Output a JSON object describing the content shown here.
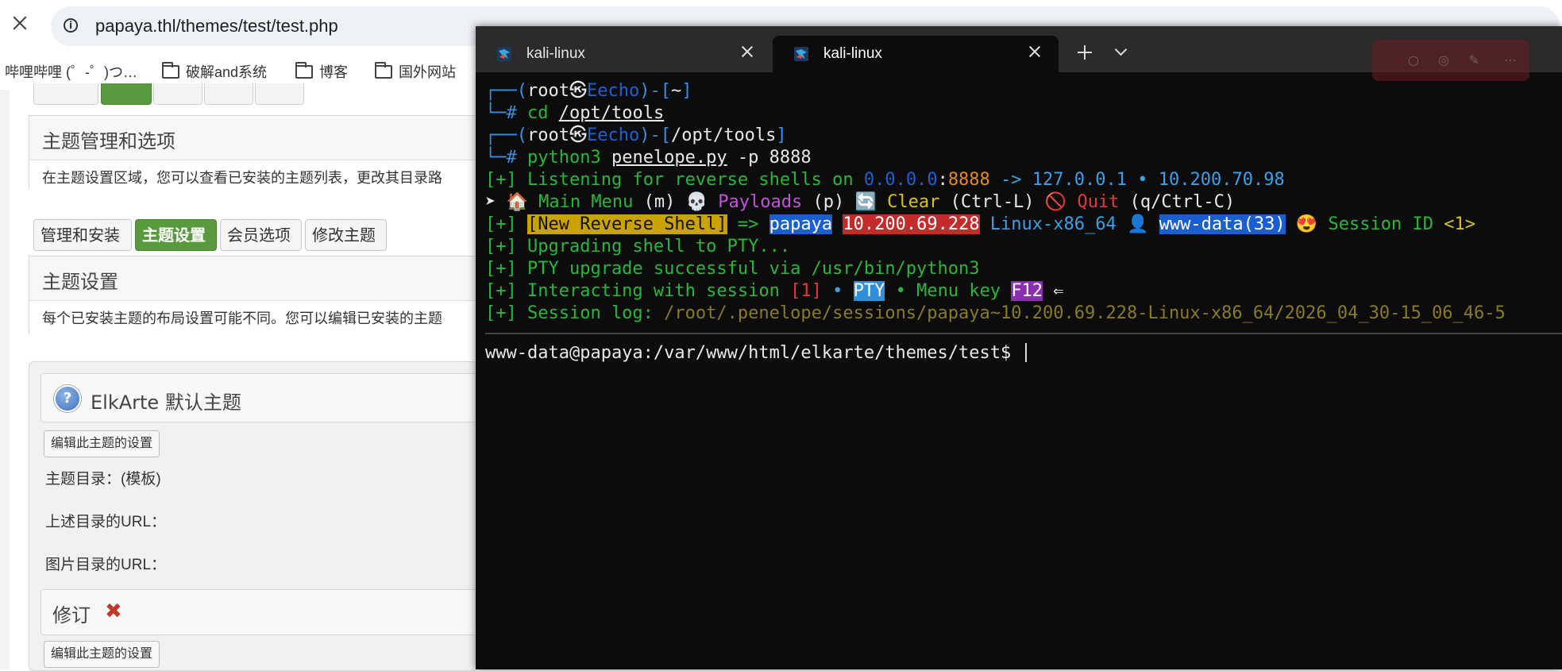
{
  "browser": {
    "url": "papaya.thl/themes/test/test.php",
    "bookmarks": [
      "哔哩哔哩 (゜-゜)つ…",
      "破解and系统",
      "博客",
      "国外网站"
    ]
  },
  "forum": {
    "section1": {
      "title": "主题管理和选项",
      "desc": "在主题设置区域，您可以查看已安装的主题列表，更改其目录路"
    },
    "tabs": [
      "管理和安装",
      "主题设置",
      "会员选项",
      "修改主题"
    ],
    "section2": {
      "title": "主题设置",
      "desc": "每个已安装主题的布局设置可能不同。您可以编辑已安装的主题"
    },
    "theme": {
      "name": "ElkArte 默认主题",
      "edit_button": "编辑此主题的设置",
      "dir_label": "主题目录：(模板)",
      "url_label": "上述目录的URL：",
      "img_label": "图片目录的URL："
    },
    "revision": {
      "title": "修订",
      "edit_button": "编辑此主题的设置"
    }
  },
  "terminal": {
    "tabs": [
      {
        "label": "kali-linux",
        "active": false
      },
      {
        "label": "kali-linux",
        "active": true
      }
    ],
    "lines": {
      "p1_open": "┌──(",
      "p1_user": "root",
      "p1_at": "㉿",
      "p1_host": "Eecho",
      "p1_mid": ")-[",
      "p1_dir": "~",
      "p1_close": "]",
      "c1_prompt": "└─# ",
      "c1_cmd": "cd ",
      "c1_arg": "/opt/tools",
      "p2_open": "┌──(",
      "p2_user": "root",
      "p2_at": "㉿",
      "p2_host": "Eecho",
      "p2_mid": ")-[",
      "p2_dir": "/opt/tools",
      "p2_close": "]",
      "c2_prompt": "└─# ",
      "c2_cmd": "python3 ",
      "c2_file": "penelope.py",
      "c2_args": " -p 8888",
      "l1_tag": "[+]",
      "l1_text": " Listening for reverse shells on ",
      "l1_ip": "0.0.0.0",
      "l1_colon": ":",
      "l1_port": "8888",
      "l1_arrow": " -> ",
      "l1_ip2": "127.0.0.1",
      "l1_dot": " • ",
      "l1_ip3": "10.200.70.98",
      "m_arrow": "➤ ",
      "m_home": "🏠",
      "m_main": " Main Menu",
      "m_main_key": " (m) ",
      "m_skull": "💀",
      "m_payloads": " Payloads",
      "m_payloads_key": " (p) ",
      "m_clear_ic": "🔄",
      "m_clear": " Clear",
      "m_clear_key": " (Ctrl-L) ",
      "m_quit_ic": "🚫",
      "m_quit": " Quit",
      "m_quit_key": " (q/Ctrl-C)",
      "l2_tag": "[+] ",
      "l2_new": "[New Reverse Shell]",
      "l2_arrow": " => ",
      "l2_host": "papaya",
      "l2_sp1": " ",
      "l2_ip": "10.200.69.228",
      "l2_os": " Linux-x86_64 ",
      "l2_user_ic": "👤",
      "l2_sp2": " ",
      "l2_user": "www-data(33)",
      "l2_sp3": " ",
      "l2_face": "😍",
      "l2_sid": " Session ID ",
      "l2_sid_val": "<1>",
      "l3": "[+] Upgrading shell to PTY...",
      "l4": "[+] PTY upgrade successful via /usr/bin/python3",
      "l5_a": "[+] Interacting with session ",
      "l5_num": "[1]",
      "l5_dot1": " • ",
      "l5_pty": "PTY",
      "l5_dot2": " • Menu key ",
      "l5_key": "F12",
      "l5_arrow": " ⇐",
      "l6_a": "[+] Session log: ",
      "l6_path": "/root/.penelope/sessions/papaya~10.200.69.228-Linux-x86_64/2026_04_30-15_06_46-5",
      "shell_prompt": "www-data@papaya:/var/www/html/elkarte/themes/test$ "
    }
  },
  "colors": {
    "terminal_bg": "#0c0c0c",
    "forum_green": "#5a9a3e",
    "prompt_blue": "#3a8ee6",
    "log_green": "#27b838"
  }
}
